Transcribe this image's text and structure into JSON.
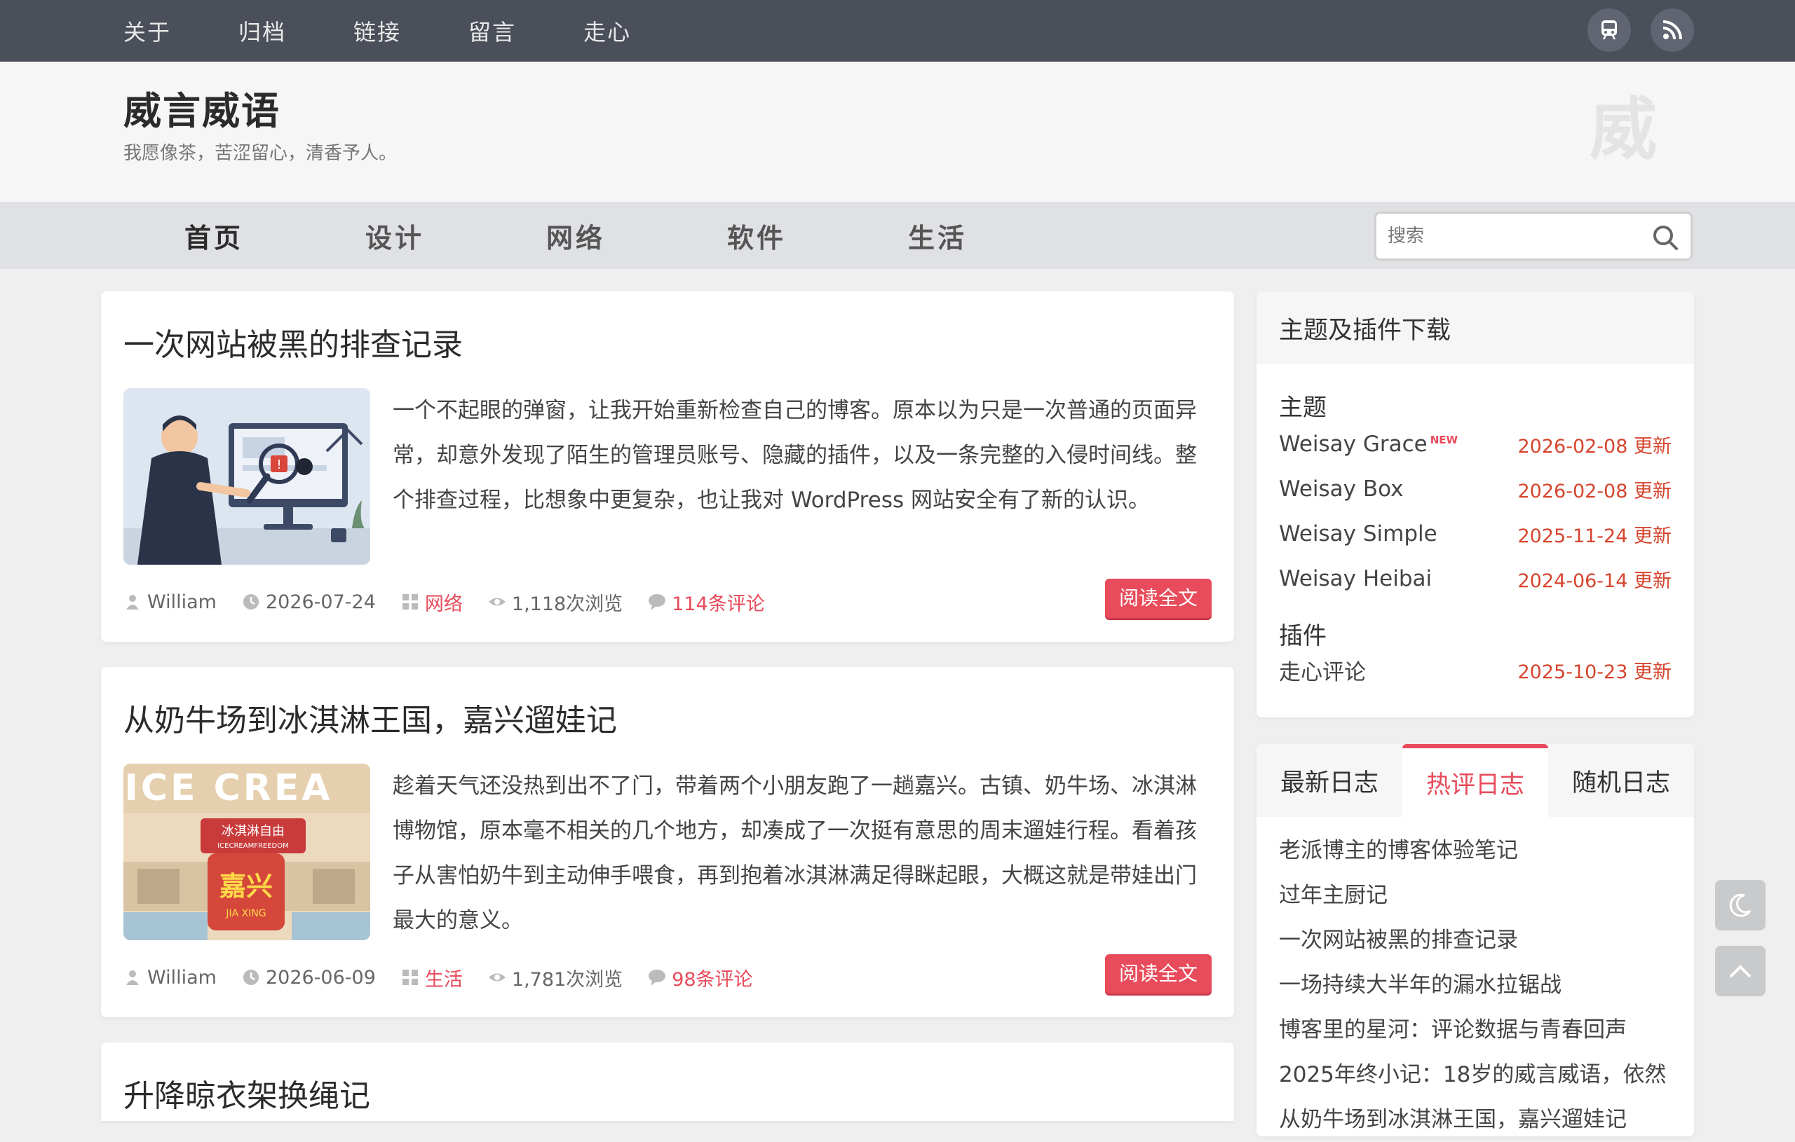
{
  "topnav": [
    "关于",
    "归档",
    "链接",
    "留言",
    "走心"
  ],
  "icons": {
    "subway": "subway-icon",
    "rss": "rss-icon"
  },
  "site": {
    "title": "威言威语",
    "desc": "我愿像茶，苦涩留心，清香予人。",
    "logo": "威"
  },
  "mainnav": [
    "首页",
    "设计",
    "网络",
    "软件",
    "生活"
  ],
  "search": {
    "placeholder": "搜索"
  },
  "accent": "#e84b5b",
  "posts": [
    {
      "title": "一次网站被黑的排查记录",
      "excerpt": "一个不起眼的弹窗，让我开始重新检查自己的博客。原本以为只是一次普通的页面异常，却意外发现了陌生的管理员账号、隐藏的插件，以及一条完整的入侵时间线。整个排查过程，比想象中更复杂，也让我对 WordPress 网站安全有了新的认识。",
      "author": "William",
      "date": "2026-07-24",
      "category": "网络",
      "views": "1,118次浏览",
      "comments": "114条评论",
      "read": "阅读全文"
    },
    {
      "title": "从奶牛场到冰淇淋王国，嘉兴遛娃记",
      "excerpt": "趁着天气还没热到出不了门，带着两个小朋友跑了一趟嘉兴。古镇、奶牛场、冰淇淋博物馆，原本毫不相关的几个地方，却凑成了一次挺有意思的周末遛娃行程。看着孩子从害怕奶牛到主动伸手喂食，再到抱着冰淇淋满足得眯起眼，大概这就是带娃出门最大的意义。",
      "author": "William",
      "date": "2026-06-09",
      "category": "生活",
      "views": "1,781次浏览",
      "comments": "98条评论",
      "read": "阅读全文",
      "thumb_text": {
        "top": "ICE CREA",
        "sign": "冰淇淋自由",
        "sign_en": "ICECREAMFREEDOM",
        "city": "嘉兴",
        "city_en": "JIA XING"
      }
    },
    {
      "title": "升降晾衣架换绳记"
    }
  ],
  "widget_download": {
    "title": "主题及插件下载",
    "themes_label": "主题",
    "new_tag": "NEW",
    "themes": [
      {
        "name": "Weisay Grace",
        "date": "2026-02-08 更新"
      },
      {
        "name": "Weisay Box",
        "date": "2026-02-08 更新"
      },
      {
        "name": "Weisay Simple",
        "date": "2025-11-24 更新"
      },
      {
        "name": "Weisay Heibai",
        "date": "2024-06-14 更新"
      }
    ],
    "plugins_label": "插件",
    "plugins": [
      {
        "name": "走心评论",
        "date": "2025-10-23 更新"
      }
    ]
  },
  "widget_posts": {
    "tabs": [
      "最新日志",
      "热评日志",
      "随机日志"
    ],
    "active_tab": 1,
    "items": [
      "老派博主的博客体验笔记",
      "过年主厨记",
      "一次网站被黑的排查记录",
      "一场持续大半年的漏水拉锯战",
      "博客里的星河：评论数据与青春回声",
      "2025年终小记：18岁的威言威语，依然",
      "从奶牛场到冰淇淋王国，嘉兴遛娃记"
    ]
  }
}
